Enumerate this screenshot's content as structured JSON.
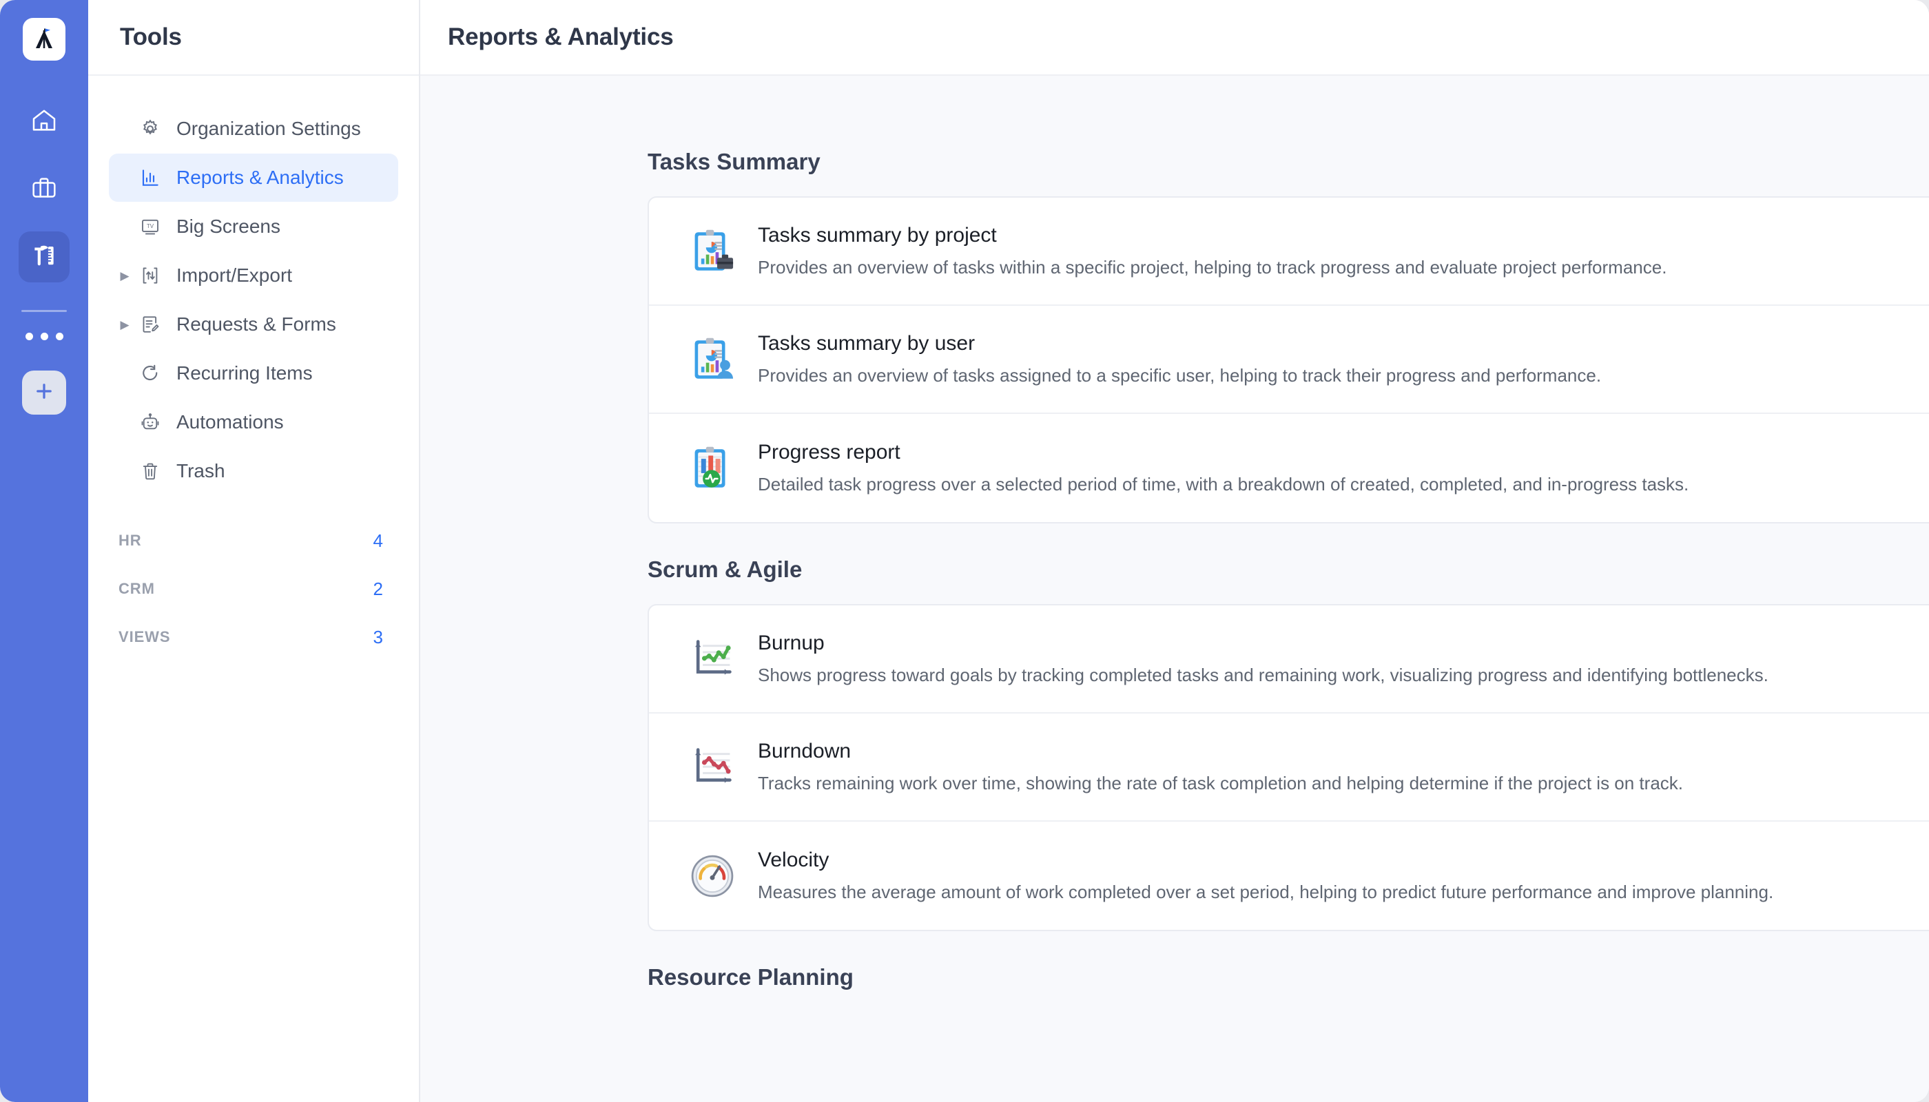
{
  "rail": {
    "logo_icon": "company-logo-mountain-flag-icon",
    "items": [
      {
        "icon": "home-icon",
        "name": "home",
        "active": false
      },
      {
        "icon": "briefcase-icon",
        "name": "workspace",
        "active": false
      },
      {
        "icon": "tools-hammer-ruler-icon",
        "name": "tools",
        "active": true
      }
    ],
    "more_icon": "more-horizontal-icon",
    "add_icon": "plus-icon"
  },
  "sidebar": {
    "title": "Tools",
    "items": [
      {
        "label": "Organization Settings",
        "icon": "gear-icon",
        "caret": false,
        "active": false
      },
      {
        "label": "Reports & Analytics",
        "icon": "bar-chart-icon",
        "caret": false,
        "active": true
      },
      {
        "label": "Big Screens",
        "icon": "tv-icon",
        "caret": false,
        "active": false
      },
      {
        "label": "Import/Export",
        "icon": "import-export-icon",
        "caret": true,
        "active": false
      },
      {
        "label": "Requests & Forms",
        "icon": "form-edit-icon",
        "caret": true,
        "active": false
      },
      {
        "label": "Recurring Items",
        "icon": "refresh-icon",
        "caret": false,
        "active": false
      },
      {
        "label": "Automations",
        "icon": "robot-icon",
        "caret": false,
        "active": false
      },
      {
        "label": "Trash",
        "icon": "trash-icon",
        "caret": false,
        "active": false
      }
    ],
    "groups": [
      {
        "label": "HR",
        "count": "4"
      },
      {
        "label": "CRM",
        "count": "2"
      },
      {
        "label": "VIEWS",
        "count": "3"
      }
    ]
  },
  "header": {
    "title": "Reports & Analytics"
  },
  "main": {
    "sections": [
      {
        "title": "Tasks Summary",
        "cards": [
          {
            "icon": "clipboard-chart-briefcase-icon",
            "title": "Tasks summary by project",
            "desc": "Provides an overview of tasks within a specific project, helping to track progress and evaluate project performance."
          },
          {
            "icon": "clipboard-chart-user-icon",
            "title": "Tasks summary by user",
            "desc": "Provides an overview of tasks assigned to a specific user, helping to track their progress and performance."
          },
          {
            "icon": "clipboard-bars-pulse-icon",
            "title": "Progress report",
            "desc": "Detailed task progress over a selected period of time, with a breakdown of created, completed, and in-progress tasks."
          }
        ]
      },
      {
        "title": "Scrum & Agile",
        "cards": [
          {
            "icon": "burnup-chart-icon",
            "title": "Burnup",
            "desc": "Shows progress toward goals by tracking completed tasks and remaining work, visualizing progress and identifying bottlenecks."
          },
          {
            "icon": "burndown-chart-icon",
            "title": "Burndown",
            "desc": "Tracks remaining work over time, showing the rate of task completion and helping determine if the project is on track."
          },
          {
            "icon": "speedometer-gauge-icon",
            "title": "Velocity",
            "desc": "Measures the average amount of work completed over a set period, helping to predict future performance and improve planning."
          }
        ]
      },
      {
        "title": "Resource Planning",
        "cards": []
      }
    ]
  },
  "colors": {
    "rail_bg": "#5573dd",
    "accent": "#2d6ef5",
    "active_nav_bg": "#eaf1fe",
    "page_bg": "#f8f9fc",
    "text_dark": "#2f3749"
  }
}
